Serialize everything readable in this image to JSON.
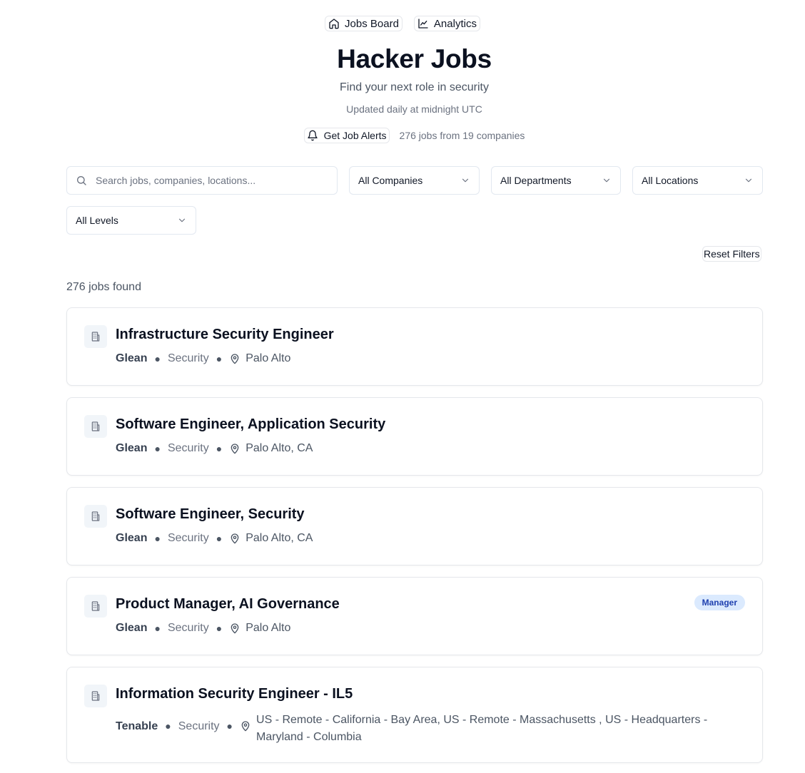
{
  "nav": {
    "jobs_board": "Jobs Board",
    "analytics": "Analytics"
  },
  "header": {
    "title": "Hacker Jobs",
    "subtitle": "Find your next role in security",
    "updated": "Updated daily at midnight UTC",
    "alerts_button": "Get Job Alerts",
    "job_stats": "276 jobs from 19 companies"
  },
  "filters": {
    "search_placeholder": "Search jobs, companies, locations...",
    "search_value": "",
    "company": "All Companies",
    "department": "All Departments",
    "location": "All Locations",
    "level": "All Levels",
    "reset_label": "Reset Filters"
  },
  "results": {
    "count_label": "276 jobs found"
  },
  "jobs": [
    {
      "title": "Infrastructure Security Engineer",
      "company": "Glean",
      "department": "Security",
      "location": "Palo Alto",
      "badge": ""
    },
    {
      "title": "Software Engineer, Application Security",
      "company": "Glean",
      "department": "Security",
      "location": "Palo Alto, CA",
      "badge": ""
    },
    {
      "title": "Software Engineer, Security",
      "company": "Glean",
      "department": "Security",
      "location": "Palo Alto, CA",
      "badge": ""
    },
    {
      "title": "Product Manager, AI Governance",
      "company": "Glean",
      "department": "Security",
      "location": "Palo Alto",
      "badge": "Manager"
    },
    {
      "title": "Information Security Engineer - IL5",
      "company": "Tenable",
      "department": "Security",
      "location": "US - Remote - California - Bay Area, US - Remote - Massachusetts , US - Headquarters - Maryland - Columbia",
      "badge": ""
    }
  ],
  "colors": {
    "badge_bg": "#dbeafe",
    "badge_text": "#1e40af",
    "border": "#e5e7eb"
  }
}
